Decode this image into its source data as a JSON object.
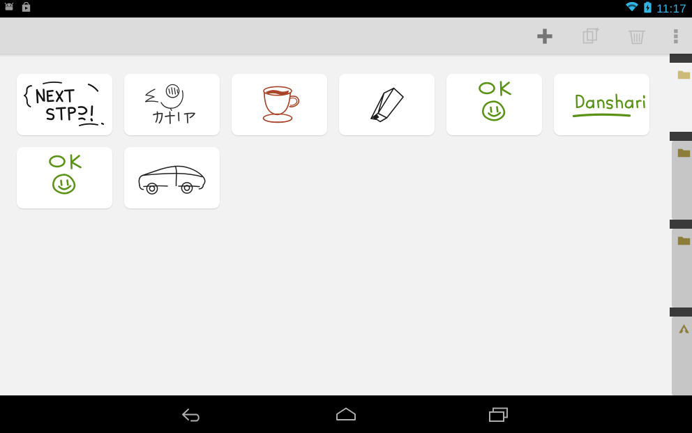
{
  "status_bar": {
    "time": "11:17",
    "icons": [
      {
        "name": "android-robot-icon",
        "label": "Android system notification"
      },
      {
        "name": "play-store-icon",
        "label": "Play Store notification"
      },
      {
        "name": "wifi-icon",
        "label": "Wi-Fi connected"
      },
      {
        "name": "battery-charging-icon",
        "label": "Battery charging"
      }
    ],
    "accent_color": "#33b5e5",
    "background_color": "#000000"
  },
  "action_bar": {
    "background_color": "#dcdcdc",
    "buttons": [
      {
        "name": "add-note-button",
        "icon": "plus-icon",
        "label": "Add",
        "enabled": true
      },
      {
        "name": "duplicate-note-button",
        "icon": "duplicate-icon",
        "label": "Duplicate",
        "enabled": false
      },
      {
        "name": "delete-note-button",
        "icon": "trash-icon",
        "label": "Delete",
        "enabled": false
      },
      {
        "name": "overflow-menu-button",
        "icon": "more-vertical-icon",
        "label": "More options",
        "enabled": true
      }
    ]
  },
  "content": {
    "background_color": "#f2f2f2",
    "card_background": "#ffffff",
    "ink_black": "#1a1a1a",
    "ink_green": "#5a9216",
    "ink_brown": "#a8442a",
    "notes": [
      {
        "name": "note-card-next-step",
        "drawing": "next-step-text",
        "text": "NEXT STEP !",
        "ink": "black"
      },
      {
        "name": "note-card-canary",
        "drawing": "bird-sketch",
        "text": "カナリア",
        "ink": "black"
      },
      {
        "name": "note-card-coffee",
        "drawing": "coffee-cup-sketch",
        "text": "",
        "ink": "brown"
      },
      {
        "name": "note-card-pencil",
        "drawing": "pencil-sketch",
        "text": "",
        "ink": "black"
      },
      {
        "name": "note-card-ok-smiley-1",
        "drawing": "ok-smiley-sketch",
        "text": "OK",
        "ink": "green"
      },
      {
        "name": "note-card-danshari",
        "drawing": "danshari-text",
        "text": "Danshari",
        "ink": "green"
      },
      {
        "name": "note-card-ok-smiley-2",
        "drawing": "ok-smiley-sketch",
        "text": "OK",
        "ink": "green"
      },
      {
        "name": "note-card-car",
        "drawing": "car-sketch",
        "text": "",
        "ink": "black"
      }
    ]
  },
  "sidebar": {
    "background_color": "#f2f2f2",
    "tab_color": "#c6c6c6",
    "separator_color": "#3a3a3a",
    "folder_color_light": "#ccbb78",
    "folder_color_dark": "#8c7e3a",
    "items": [
      {
        "name": "sidebar-folder-1",
        "icon": "folder-icon",
        "selected": true
      },
      {
        "name": "sidebar-folder-2",
        "icon": "folder-icon",
        "selected": false
      },
      {
        "name": "sidebar-folder-3",
        "icon": "folder-icon",
        "selected": false
      },
      {
        "name": "sidebar-drive",
        "icon": "google-drive-icon",
        "selected": false
      }
    ]
  },
  "nav_bar": {
    "background_color": "#000000",
    "buttons": [
      {
        "name": "nav-back-button",
        "icon": "back-arrow-icon",
        "label": "Back"
      },
      {
        "name": "nav-home-button",
        "icon": "home-icon",
        "label": "Home"
      },
      {
        "name": "nav-recents-button",
        "icon": "recents-icon",
        "label": "Recent apps"
      }
    ]
  }
}
